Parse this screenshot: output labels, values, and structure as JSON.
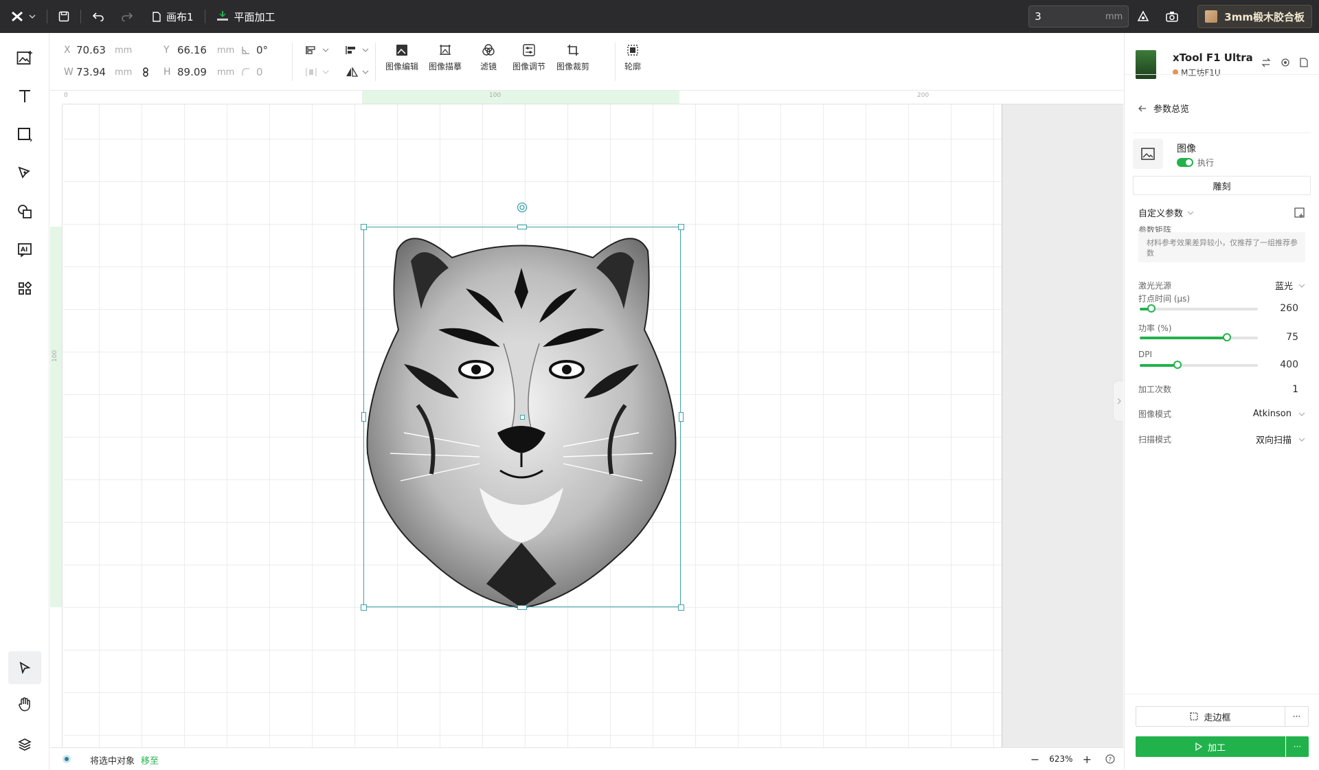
{
  "topbar": {
    "doc_name": "画布1",
    "mode": "平面加工",
    "thickness_value": "3",
    "thickness_unit": "mm",
    "material": "3mm椴木胶合板"
  },
  "props": {
    "x_label": "X",
    "x_value": "70.63",
    "x_unit": "mm",
    "y_label": "Y",
    "y_value": "66.16",
    "y_unit": "mm",
    "w_label": "W",
    "w_value": "73.94",
    "w_unit": "mm",
    "h_label": "H",
    "h_value": "89.09",
    "h_unit": "mm",
    "rotation": "0°",
    "corner": "0"
  },
  "tools": {
    "image_edit": "图像编辑",
    "image_trace": "图像描摹",
    "filter": "滤镜",
    "image_adjust": "图像调节",
    "image_crop": "图像裁剪",
    "outline": "轮廓"
  },
  "ruler": {
    "t0": "0",
    "t100": "100",
    "t200": "200",
    "l100": "100"
  },
  "device": {
    "name": "xTool F1 Ultra",
    "workshop": "M工坊F1U"
  },
  "panel": {
    "back_label": "参数总览",
    "layer_name": "图像",
    "exec_label": "执行",
    "engrave_btn": "雕刻",
    "custom_params": "自定义参数",
    "matrix_label": "参数矩阵",
    "matrix_hint": "材料参考效果差异较小，仅推荐了一组推荐参数",
    "laser_label": "激光光源",
    "laser_value": "蓝光",
    "dot_time_label": "打点时间 (μs)",
    "dot_time_value": "260",
    "power_label": "功率 (%)",
    "power_value": "75",
    "dpi_label": "DPI",
    "dpi_value": "400",
    "passes_label": "加工次数",
    "passes_value": "1",
    "image_mode_label": "图像模式",
    "image_mode_value": "Atkinson",
    "scan_mode_label": "扫描模式",
    "scan_mode_value": "双向扫描",
    "frame_btn": "走边框",
    "process_btn": "加工",
    "more": "···"
  },
  "sliders": {
    "dot_time": 0.1,
    "power": 0.74,
    "dpi": 0.32
  },
  "status": {
    "text": "将选中对象",
    "link": "移至",
    "zoom": "623%"
  },
  "colors": {
    "accent": "#22b24c",
    "selection": "#3aa0a8",
    "topbar": "#2b2b2e"
  }
}
